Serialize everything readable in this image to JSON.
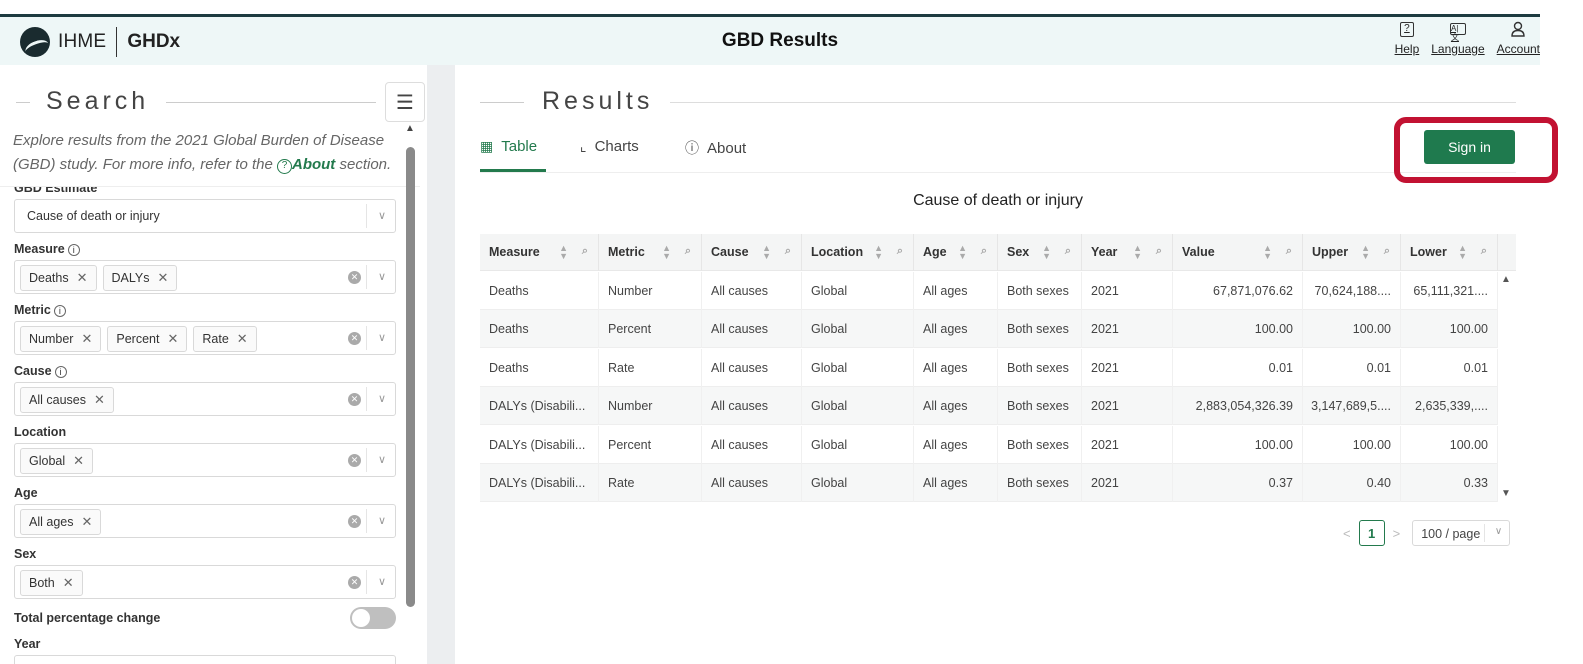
{
  "header": {
    "brand_ihme": "IHME",
    "brand_ghdx": "GHDx",
    "title": "GBD Results",
    "actions": [
      {
        "label": "Help",
        "icon": "help-icon"
      },
      {
        "label": "Language",
        "icon": "language-icon"
      },
      {
        "label": "Account",
        "icon": "account-icon"
      }
    ]
  },
  "search": {
    "title": "Search",
    "intro_text": "Explore results from the 2021 Global Burden of Disease (GBD) study. For more info, refer to the",
    "intro_link": "About",
    "intro_suffix": "section.",
    "filters": {
      "gbd_estimate_label": "GBD Estimate",
      "gbd_estimate_value": "Cause of death or injury",
      "measure_label": "Measure",
      "measure_tags": [
        "Deaths",
        "DALYs"
      ],
      "metric_label": "Metric",
      "metric_tags": [
        "Number",
        "Percent",
        "Rate"
      ],
      "cause_label": "Cause",
      "cause_tags": [
        "All causes"
      ],
      "location_label": "Location",
      "location_tags": [
        "Global"
      ],
      "age_label": "Age",
      "age_tags": [
        "All ages"
      ],
      "sex_label": "Sex",
      "sex_tags": [
        "Both"
      ],
      "total_pct_label": "Total percentage change",
      "year_label": "Year"
    }
  },
  "results": {
    "title": "Results",
    "tabs": [
      {
        "label": "Table",
        "icon": "table-icon"
      },
      {
        "label": "Charts",
        "icon": "chart-icon"
      },
      {
        "label": "About",
        "icon": "question-icon"
      }
    ],
    "sign_in": "Sign in",
    "table_title": "Cause of death or injury",
    "columns": [
      "Measure",
      "Metric",
      "Cause",
      "Location",
      "Age",
      "Sex",
      "Year",
      "Value",
      "Upper",
      "Lower"
    ],
    "rows": [
      [
        "Deaths",
        "Number",
        "All causes",
        "Global",
        "All ages",
        "Both sexes",
        "2021",
        "67,871,076.62",
        "70,624,188....",
        "65,111,321...."
      ],
      [
        "Deaths",
        "Percent",
        "All causes",
        "Global",
        "All ages",
        "Both sexes",
        "2021",
        "100.00",
        "100.00",
        "100.00"
      ],
      [
        "Deaths",
        "Rate",
        "All causes",
        "Global",
        "All ages",
        "Both sexes",
        "2021",
        "0.01",
        "0.01",
        "0.01"
      ],
      [
        "DALYs (Disabili...",
        "Number",
        "All causes",
        "Global",
        "All ages",
        "Both sexes",
        "2021",
        "2,883,054,326.39",
        "3,147,689,5....",
        "2,635,339,...."
      ],
      [
        "DALYs (Disabili...",
        "Percent",
        "All causes",
        "Global",
        "All ages",
        "Both sexes",
        "2021",
        "100.00",
        "100.00",
        "100.00"
      ],
      [
        "DALYs (Disabili...",
        "Rate",
        "All causes",
        "Global",
        "All ages",
        "Both sexes",
        "2021",
        "0.37",
        "0.40",
        "0.33"
      ]
    ],
    "pager": {
      "current": "1",
      "page_size": "100 / page"
    }
  },
  "colors": {
    "accent": "#237a4d",
    "button": "#1f7a4e",
    "highlight": "#c21232"
  }
}
